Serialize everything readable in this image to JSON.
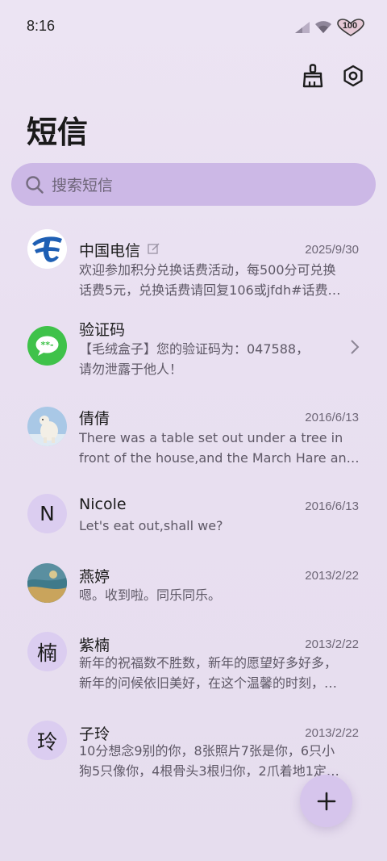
{
  "status": {
    "time": "8:16",
    "battery": "100"
  },
  "header": {
    "title": "短信"
  },
  "search": {
    "placeholder": "搜索短信"
  },
  "messages": [
    {
      "name": "中国电信",
      "date": "2025/9/30",
      "line1": "欢迎参加积分兑换话费活动，每500分可兑换",
      "line2": "话费5元，兑换话费请回复106或jfdh#话费…",
      "avatar": "china-telecom-logo"
    },
    {
      "name": "验证码",
      "date": "",
      "line1": "【毛绒盒子】您的验证码为：047588，",
      "line2": "请勿泄露于他人！",
      "avatar": "verification-code-icon"
    },
    {
      "name": "倩倩",
      "date": "2016/6/13",
      "line1": "There was a table set out under a tree in",
      "line2": "front of the house,and the March Hare an…",
      "avatar": "polar-bear-photo"
    },
    {
      "name": "Nicole",
      "date": "2016/6/13",
      "line1": "Let's eat out,shall we?",
      "line2": "",
      "avatar_letter": "N"
    },
    {
      "name": "燕婷",
      "date": "2013/2/22",
      "line1": "嗯。收到啦。同乐同乐。",
      "line2": "",
      "avatar": "landscape-photo"
    },
    {
      "name": "紫楠",
      "date": "2013/2/22",
      "line1": "新年的祝福数不胜数，新年的愿望好多好多，",
      "line2": "新年的问候依旧美好，在这个温馨的时刻，…",
      "avatar_letter": "楠"
    },
    {
      "name": "子玲",
      "date": "2013/2/22",
      "line1": "10分想念9别的你，8张照片7张是你，6只小",
      "line2": "狗5只像你，4根骨头3根归你，2爪着地1定…",
      "avatar_letter": "玲"
    }
  ],
  "colors": {
    "accent": "#ccb8e6",
    "background": "#ebe3f2",
    "telecom_blue": "#1e5fb4",
    "code_green": "#3fc24a"
  }
}
